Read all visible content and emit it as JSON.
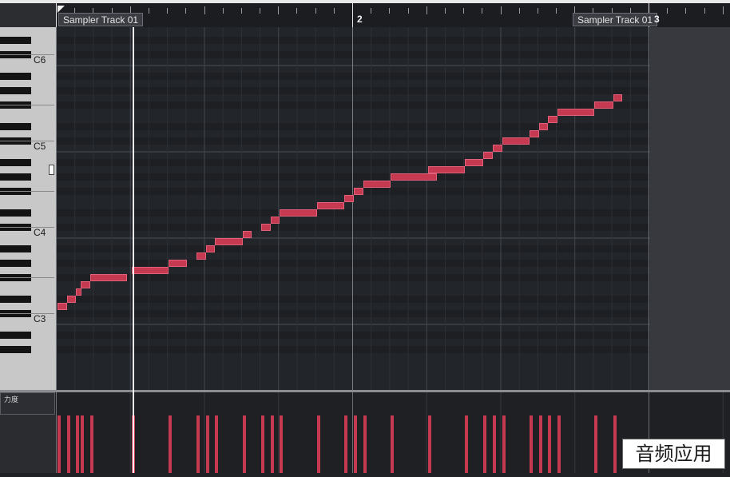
{
  "ruler": {
    "bar_labels": [
      "2",
      "3"
    ],
    "part_labels": [
      "Sampler Track 01",
      "Sampler Track 01"
    ]
  },
  "keyboard": {
    "labels": [
      "C6",
      "C5",
      "C4",
      "C3"
    ]
  },
  "velocity": {
    "label": "力度"
  },
  "watermark": {
    "text": "音频应用"
  },
  "colors": {
    "note_fill": "#c53a50",
    "background": "#22252a"
  },
  "notes": [
    {
      "start": 0.0,
      "len": 0.125,
      "pitch": 50
    },
    {
      "start": 0.125,
      "len": 0.125,
      "pitch": 51
    },
    {
      "start": 0.25,
      "len": 0.0625,
      "pitch": 52
    },
    {
      "start": 0.3125,
      "len": 0.125,
      "pitch": 53
    },
    {
      "start": 0.4375,
      "len": 0.5,
      "pitch": 54
    },
    {
      "start": 1.0,
      "len": 0.5,
      "pitch": 55
    },
    {
      "start": 1.5,
      "len": 0.25,
      "pitch": 56
    },
    {
      "start": 1.875,
      "len": 0.125,
      "pitch": 57
    },
    {
      "start": 2.0,
      "len": 0.125,
      "pitch": 58
    },
    {
      "start": 2.125,
      "len": 0.375,
      "pitch": 59
    },
    {
      "start": 2.5,
      "len": 0.125,
      "pitch": 60
    },
    {
      "start": 2.75,
      "len": 0.125,
      "pitch": 61
    },
    {
      "start": 2.875,
      "len": 0.125,
      "pitch": 62
    },
    {
      "start": 3.0,
      "len": 0.5,
      "pitch": 63
    },
    {
      "start": 3.5,
      "len": 0.375,
      "pitch": 64
    },
    {
      "start": 3.875,
      "len": 0.125,
      "pitch": 65
    },
    {
      "start": 4.0,
      "len": 0.125,
      "pitch": 66
    },
    {
      "start": 4.125,
      "len": 0.375,
      "pitch": 67
    },
    {
      "start": 4.5,
      "len": 0.625,
      "pitch": 68
    },
    {
      "start": 5.0,
      "len": 0.5,
      "pitch": 69
    },
    {
      "start": 5.5,
      "len": 0.25,
      "pitch": 70
    },
    {
      "start": 5.75,
      "len": 0.125,
      "pitch": 71
    },
    {
      "start": 5.875,
      "len": 0.125,
      "pitch": 72
    },
    {
      "start": 6.0,
      "len": 0.375,
      "pitch": 73
    },
    {
      "start": 6.375,
      "len": 0.125,
      "pitch": 74
    },
    {
      "start": 6.5,
      "len": 0.125,
      "pitch": 75
    },
    {
      "start": 6.625,
      "len": 0.125,
      "pitch": 76
    },
    {
      "start": 6.75,
      "len": 0.5,
      "pitch": 77
    },
    {
      "start": 7.25,
      "len": 0.25,
      "pitch": 78
    },
    {
      "start": 7.5,
      "len": 0.125,
      "pitch": 79
    }
  ]
}
